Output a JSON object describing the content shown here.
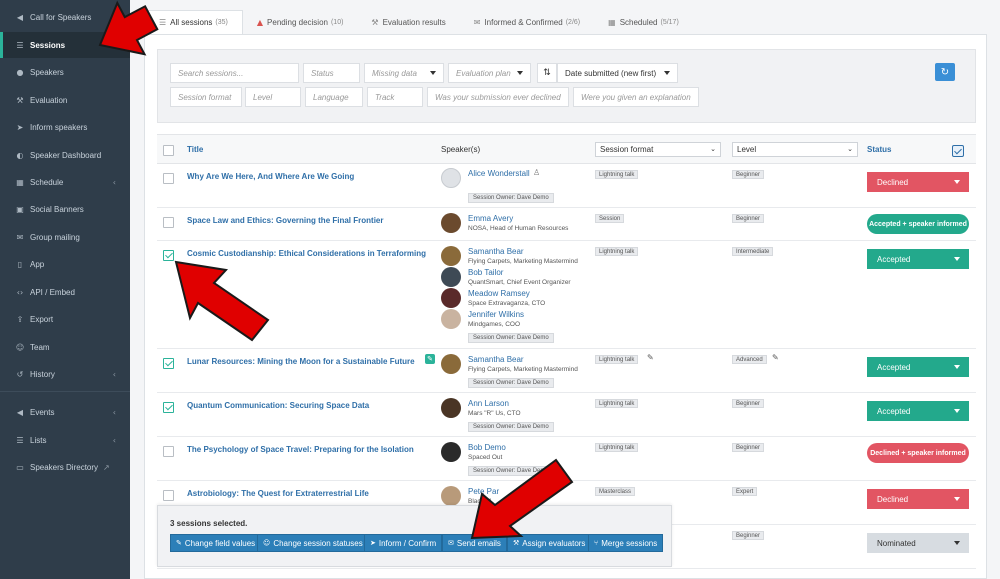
{
  "sidebar": {
    "items": [
      {
        "label": "Call for Speakers",
        "icon": "megaphone-icon",
        "chev": ""
      },
      {
        "label": "Sessions",
        "icon": "list-icon",
        "chev": ""
      },
      {
        "label": "Speakers",
        "icon": "user-icon",
        "chev": ""
      },
      {
        "label": "Evaluation",
        "icon": "gavel-icon",
        "chev": ""
      },
      {
        "label": "Inform speakers",
        "icon": "send-icon",
        "chev": ""
      },
      {
        "label": "Speaker Dashboard",
        "icon": "dashboard-icon",
        "chev": ""
      },
      {
        "label": "Schedule",
        "icon": "calendar-icon",
        "chev": "‹"
      },
      {
        "label": "Social Banners",
        "icon": "image-icon",
        "chev": ""
      },
      {
        "label": "Group mailing",
        "icon": "mail-icon",
        "chev": ""
      },
      {
        "label": "App",
        "icon": "mobile-icon",
        "chev": ""
      },
      {
        "label": "API / Embed",
        "icon": "code-icon",
        "chev": ""
      },
      {
        "label": "Export",
        "icon": "export-icon",
        "chev": ""
      },
      {
        "label": "Team",
        "icon": "team-icon",
        "chev": ""
      },
      {
        "label": "History",
        "icon": "history-icon",
        "chev": "‹"
      },
      {
        "label": "Events",
        "icon": "events-icon",
        "chev": "‹"
      },
      {
        "label": "Lists",
        "icon": "lists-icon",
        "chev": "‹"
      },
      {
        "label": "Speakers Directory",
        "icon": "directory-icon",
        "chev": "↗"
      }
    ]
  },
  "tabs": [
    {
      "label": "All sessions",
      "count": "(35)"
    },
    {
      "label": "Pending decision",
      "count": "(10)"
    },
    {
      "label": "Evaluation results",
      "count": ""
    },
    {
      "label": "Informed & Confirmed",
      "count": "(2/6)"
    },
    {
      "label": "Scheduled",
      "count": "(5/17)"
    }
  ],
  "filters": {
    "search_placeholder": "Search sessions...",
    "status_placeholder": "Status",
    "missing_data": "Missing data",
    "evaluation_plan": "Evaluation plan",
    "sort_value": "Date submitted (new first)",
    "session_format": "Session format",
    "level": "Level",
    "language": "Language",
    "track": "Track",
    "q1": "Was your submission ever declined",
    "q2": "Were you given an explanation"
  },
  "table": {
    "headers": {
      "title": "Title",
      "speakers": "Speaker(s)",
      "format": "Session format",
      "level": "Level",
      "status": "Status"
    },
    "rows": [
      {
        "title": "Why Are We Here, And Where Are We Going",
        "format": "Lightning talk",
        "level": "Beginner",
        "status": "Declined",
        "speakers": [
          {
            "name": "Alice Wonderstall",
            "org": ""
          }
        ],
        "owner": "Session Owner: Dave Demo"
      },
      {
        "title": "Space Law and Ethics: Governing the Final Frontier",
        "format": "Session",
        "level": "Beginner",
        "status": "Accepted + speaker informed",
        "speakers": [
          {
            "name": "Emma Avery",
            "org": "NOSA, Head of Human Resources"
          }
        ],
        "owner": ""
      },
      {
        "title": "Cosmic Custodianship: Ethical Considerations in Terraforming",
        "format": "Lightning talk",
        "level": "Intermediate",
        "status": "Accepted",
        "speakers": [
          {
            "name": "Samantha Bear",
            "org": "Flying Carpets, Marketing Mastermind"
          },
          {
            "name": "Bob Tailor",
            "org": "QuantSmart, Chief Event Organizer"
          },
          {
            "name": "Meadow Ramsey",
            "org": "Space Extravaganza, CTO"
          },
          {
            "name": "Jennifer Wilkins",
            "org": "Mindgames, COO"
          }
        ],
        "owner": "Session Owner: Dave Demo"
      },
      {
        "title": "Lunar Resources: Mining the Moon for a Sustainable Future",
        "format": "Lightning talk",
        "level": "Advanced",
        "status": "Accepted",
        "speakers": [
          {
            "name": "Samantha Bear",
            "org": "Flying Carpets, Marketing Mastermind"
          }
        ],
        "owner": "Session Owner: Dave Demo"
      },
      {
        "title": "Quantum Communication: Securing Space Data",
        "format": "Lightning talk",
        "level": "Beginner",
        "status": "Accepted",
        "speakers": [
          {
            "name": "Ann Larson",
            "org": "Mars \"R\" Us, CTO"
          }
        ],
        "owner": "Session Owner: Dave Demo"
      },
      {
        "title": "The Psychology of Space Travel: Preparing for the Isolation",
        "format": "Lightning talk",
        "level": "Beginner",
        "status": "Declined + speaker informed",
        "speakers": [
          {
            "name": "Bob Demo",
            "org": "Spaced Out"
          }
        ],
        "owner": "Session Owner: Dave Demo"
      },
      {
        "title": "Astrobiology: The Quest for Extraterrestrial Life",
        "format": "Masterclass",
        "level": "Expert",
        "status": "Declined",
        "speakers": [
          {
            "name": "Pete Par",
            "org": "Black M"
          }
        ],
        "owner": ""
      },
      {
        "title": "",
        "format": "",
        "level": "Beginner",
        "status": "Nominated",
        "speakers": [],
        "owner": ""
      }
    ]
  },
  "bulk": {
    "selected_text": "3 sessions selected.",
    "buttons": [
      "Change field values",
      "Change session statuses",
      "Inform / Confirm",
      "Send emails",
      "Assign evaluators",
      "Merge sessions"
    ]
  },
  "colors": {
    "declined": "#e25563",
    "accepted": "#23a98c",
    "nominated": "#d7dce1",
    "link": "#2f6fa8",
    "arrow": "#e00000"
  }
}
